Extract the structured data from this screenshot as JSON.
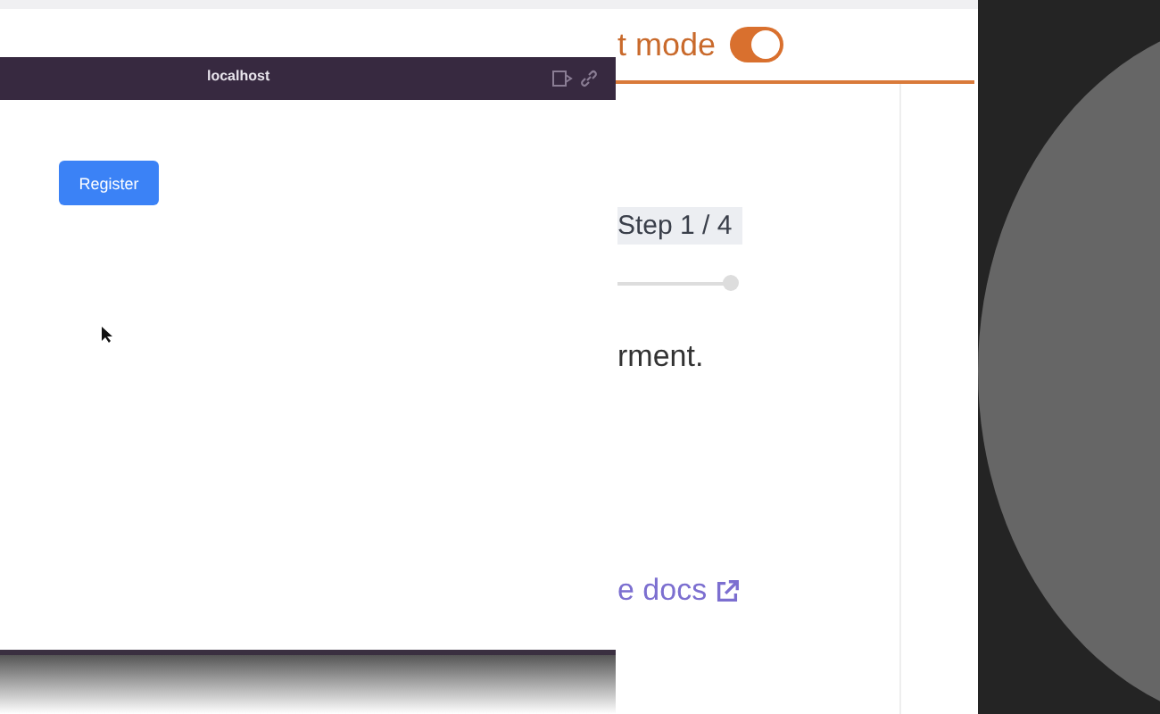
{
  "browser": {
    "title": "localhost",
    "button": "Register"
  },
  "page": {
    "toggle": {
      "label": "t mode",
      "on": true
    },
    "step": "Step 1 / 4",
    "slider": {
      "level": 1
    },
    "text": "rment.",
    "link": "e docs"
  }
}
